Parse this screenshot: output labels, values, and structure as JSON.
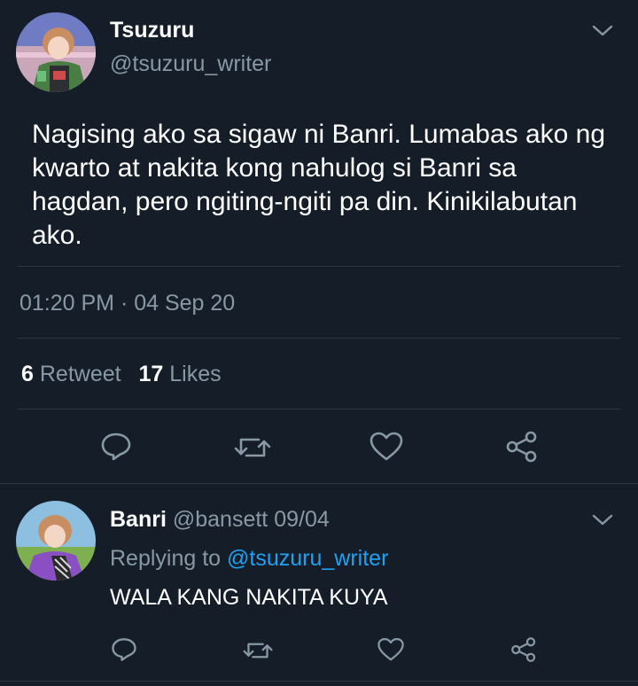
{
  "main_tweet": {
    "display_name": "Tsuzuru",
    "handle": "@tsuzuru_writer",
    "text": "Nagising ako sa sigaw ni Banri. Lumabas ako ng kwarto at nakita kong nahulog si Banri sa hagdan, pero ngiting-ngiti pa din. Kinikilabutan ako.",
    "timestamp": "01:20 PM · 04 Sep 20",
    "retweet_count": "6",
    "retweet_label": "Retweet",
    "like_count": "17",
    "like_label": "Likes"
  },
  "reply": {
    "display_name": "Banri",
    "handle": "@bansett",
    "date": "09/04",
    "replying_prefix": "Replying to",
    "replying_handle": "@tsuzuru_writer",
    "text": "WALA KANG NAKITA KUYA"
  },
  "icons": {
    "menu": "chevron-down-icon",
    "reply": "reply-icon",
    "retweet": "retweet-icon",
    "like": "heart-icon",
    "share": "share-icon"
  },
  "colors": {
    "background": "#151e28",
    "text": "#ffffff",
    "muted": "#8899a6",
    "link": "#1da1f2",
    "divider": "#2c3743"
  }
}
